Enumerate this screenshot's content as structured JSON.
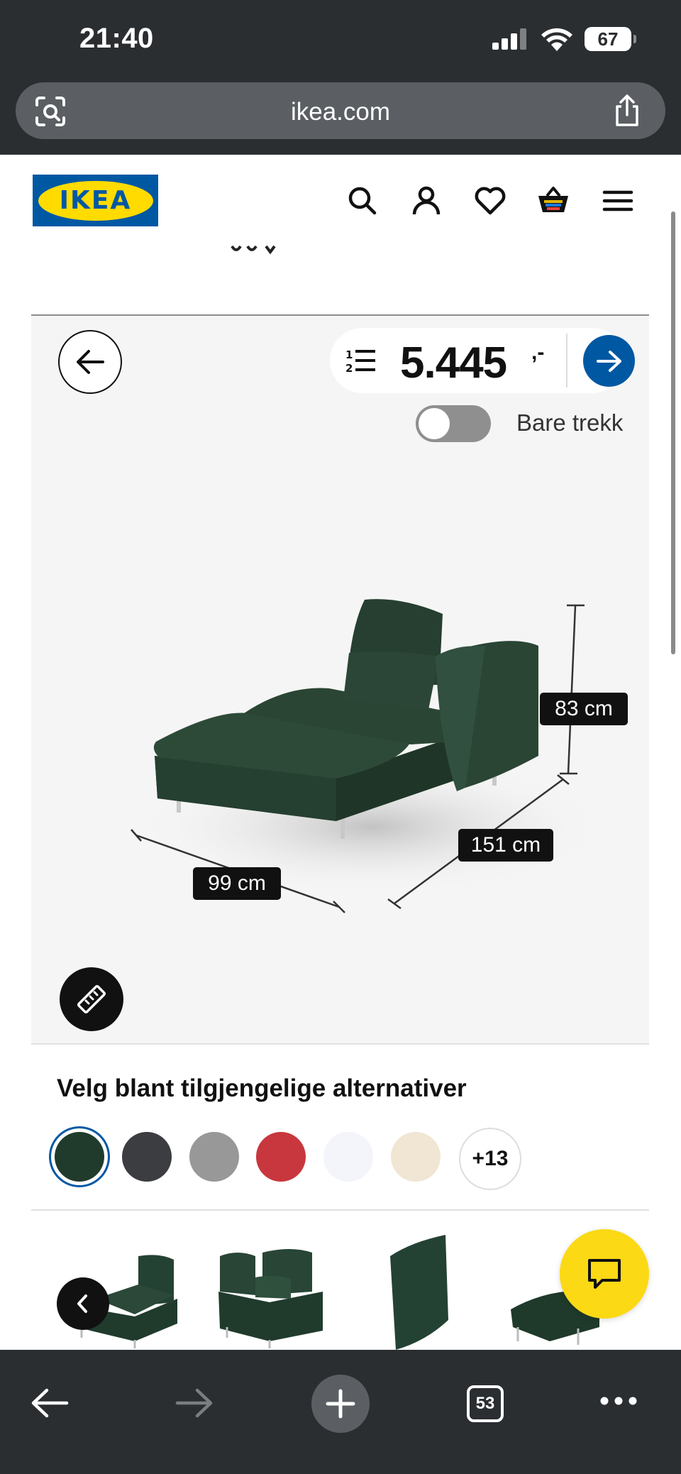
{
  "status_bar": {
    "time": "21:40",
    "battery": "67"
  },
  "browser": {
    "url": "ikea.com",
    "tab_count": "53"
  },
  "header": {
    "logo_text": "IKEA"
  },
  "viewer": {
    "price": "5.445",
    "price_suffix": ",-",
    "toggle_label": "Bare trekk",
    "toggle_on": false,
    "dimensions": {
      "height": "83 cm",
      "depth": "151 cm",
      "width": "99 cm"
    }
  },
  "options": {
    "heading": "Velg blant tilgjengelige alternativer",
    "swatches": [
      {
        "name": "dark-green",
        "color": "#203b2c",
        "selected": true
      },
      {
        "name": "dark-grey",
        "color": "#3c3d40",
        "selected": false
      },
      {
        "name": "grey",
        "color": "#989898",
        "selected": false
      },
      {
        "name": "red",
        "color": "#c8373d",
        "selected": false
      },
      {
        "name": "white",
        "color": "#f3f5fa",
        "selected": false
      },
      {
        "name": "beige",
        "color": "#f1e6d3",
        "selected": false
      }
    ],
    "more_label": "+13"
  },
  "colors": {
    "ikea_blue": "#0058a3",
    "ikea_yellow": "#ffdb00",
    "sofa_green": "#2a4534"
  }
}
